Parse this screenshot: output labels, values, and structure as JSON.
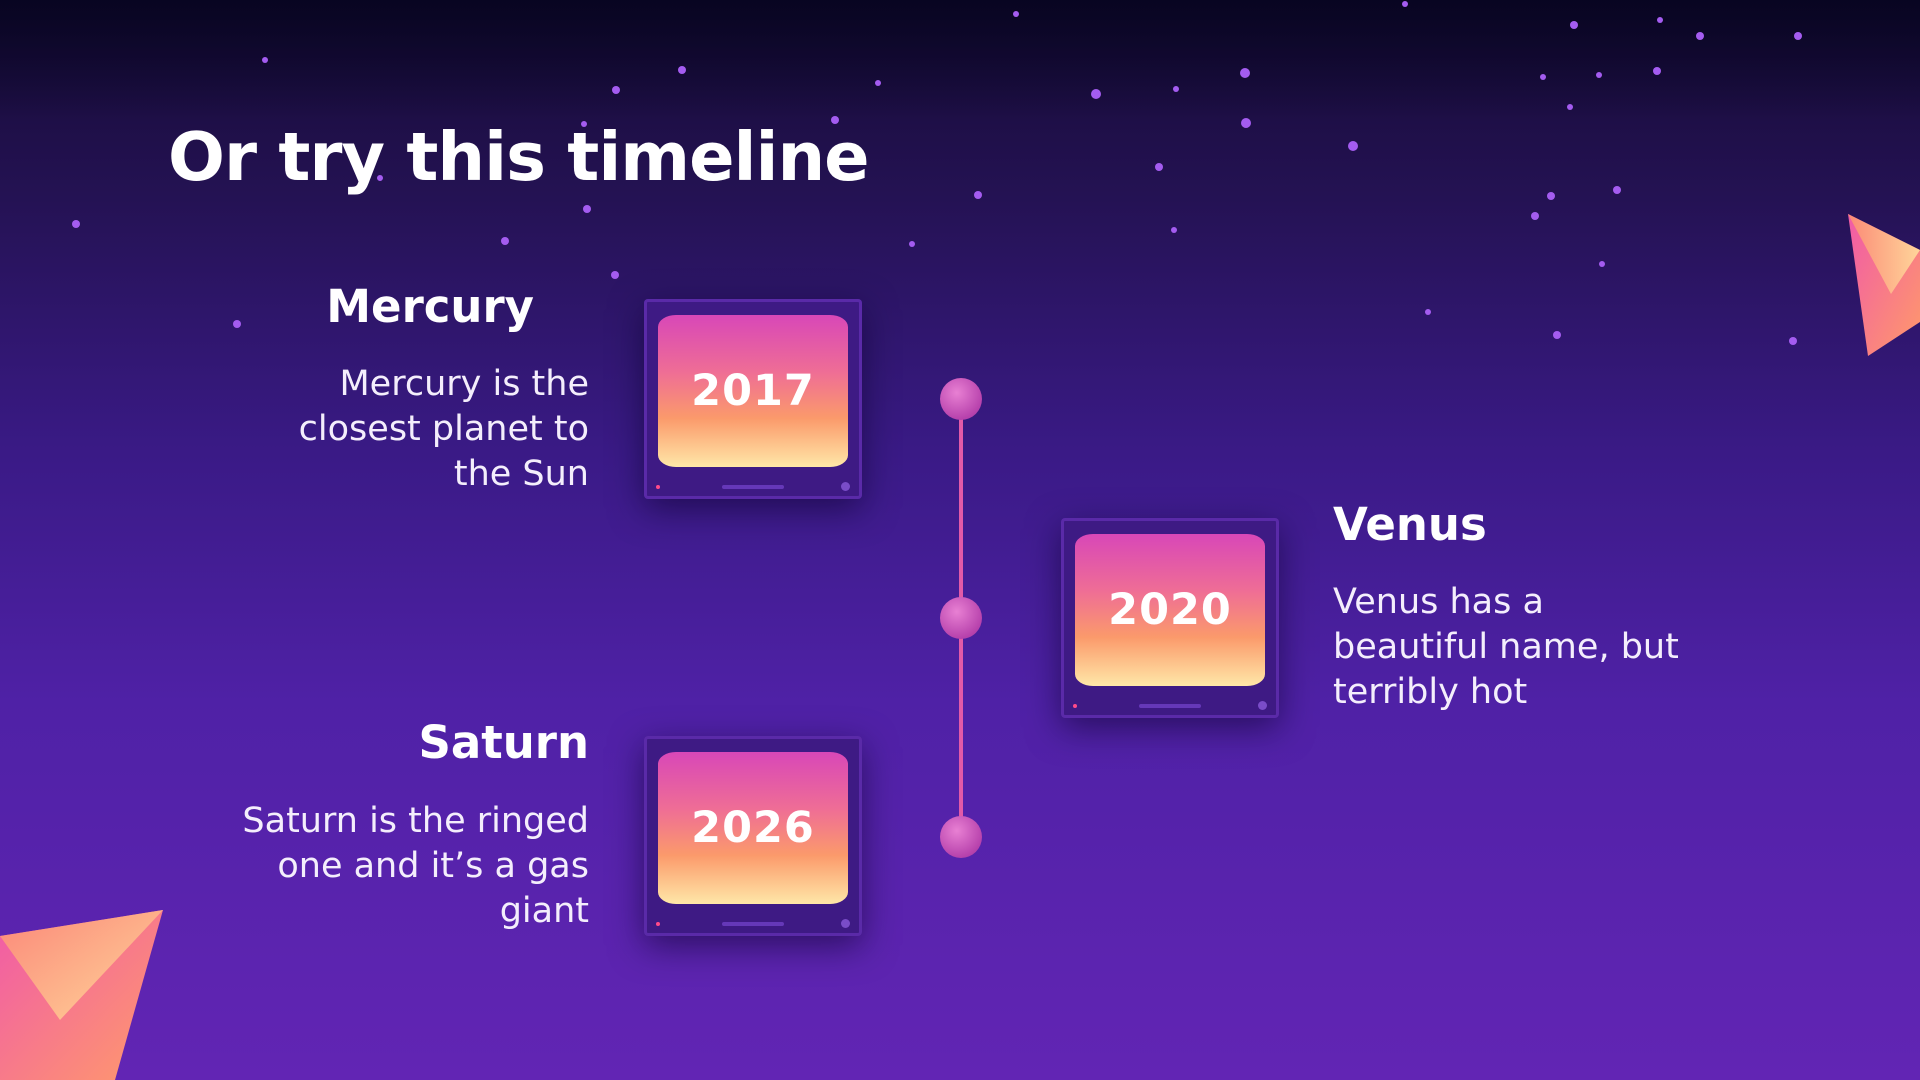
{
  "slide": {
    "title": "Or try this timeline",
    "items": [
      {
        "name": "Mercury",
        "year": "2017",
        "desc_lines": [
          "Mercury is the",
          "closest planet to",
          "the Sun"
        ]
      },
      {
        "name": "Venus",
        "year": "2020",
        "desc_lines": [
          "Venus has a",
          "beautiful name, but",
          "terribly hot"
        ]
      },
      {
        "name": "Saturn",
        "year": "2026",
        "desc_lines": [
          "Saturn is the ringed",
          "one and it’s a gas",
          "giant"
        ]
      }
    ]
  },
  "colors": {
    "accent_pink": "#e25aa8",
    "screen_top": "#d847b8",
    "screen_bottom": "#ffe7a8",
    "tv_frame": "#3e1a84"
  }
}
